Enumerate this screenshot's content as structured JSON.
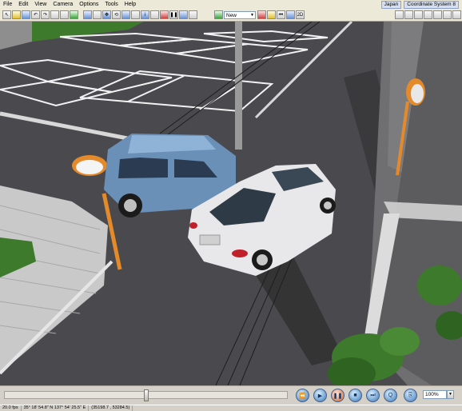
{
  "menubar": {
    "items": [
      {
        "id": "file",
        "label": "File"
      },
      {
        "id": "edit",
        "label": "Edit"
      },
      {
        "id": "view",
        "label": "View"
      },
      {
        "id": "camera",
        "label": "Camera"
      },
      {
        "id": "options",
        "label": "Options"
      },
      {
        "id": "tools",
        "label": "Tools"
      },
      {
        "id": "help",
        "label": "Help"
      }
    ],
    "region": "Japan",
    "coordinate_system": "Coordinate System 8"
  },
  "toolbar": {
    "view_select": "New",
    "view_2d_label": "2D"
  },
  "playback": {
    "position": 0.5,
    "zoom": "100%"
  },
  "status": {
    "frame": "20.0 fps",
    "coords": "35° 18' 54.8\" N  137° 54' 25.5\" E",
    "extra": "(35198.7 , 53284.5)"
  },
  "colors": {
    "asphalt": "#4a4a4e",
    "lines": "#f2f2f2",
    "blue_car": "#6a90b8",
    "white_car": "#e8e8ea",
    "mirror_pole": "#e58a2a",
    "wall": "#c9c9c9",
    "vegetation": "#3e7a2c"
  }
}
